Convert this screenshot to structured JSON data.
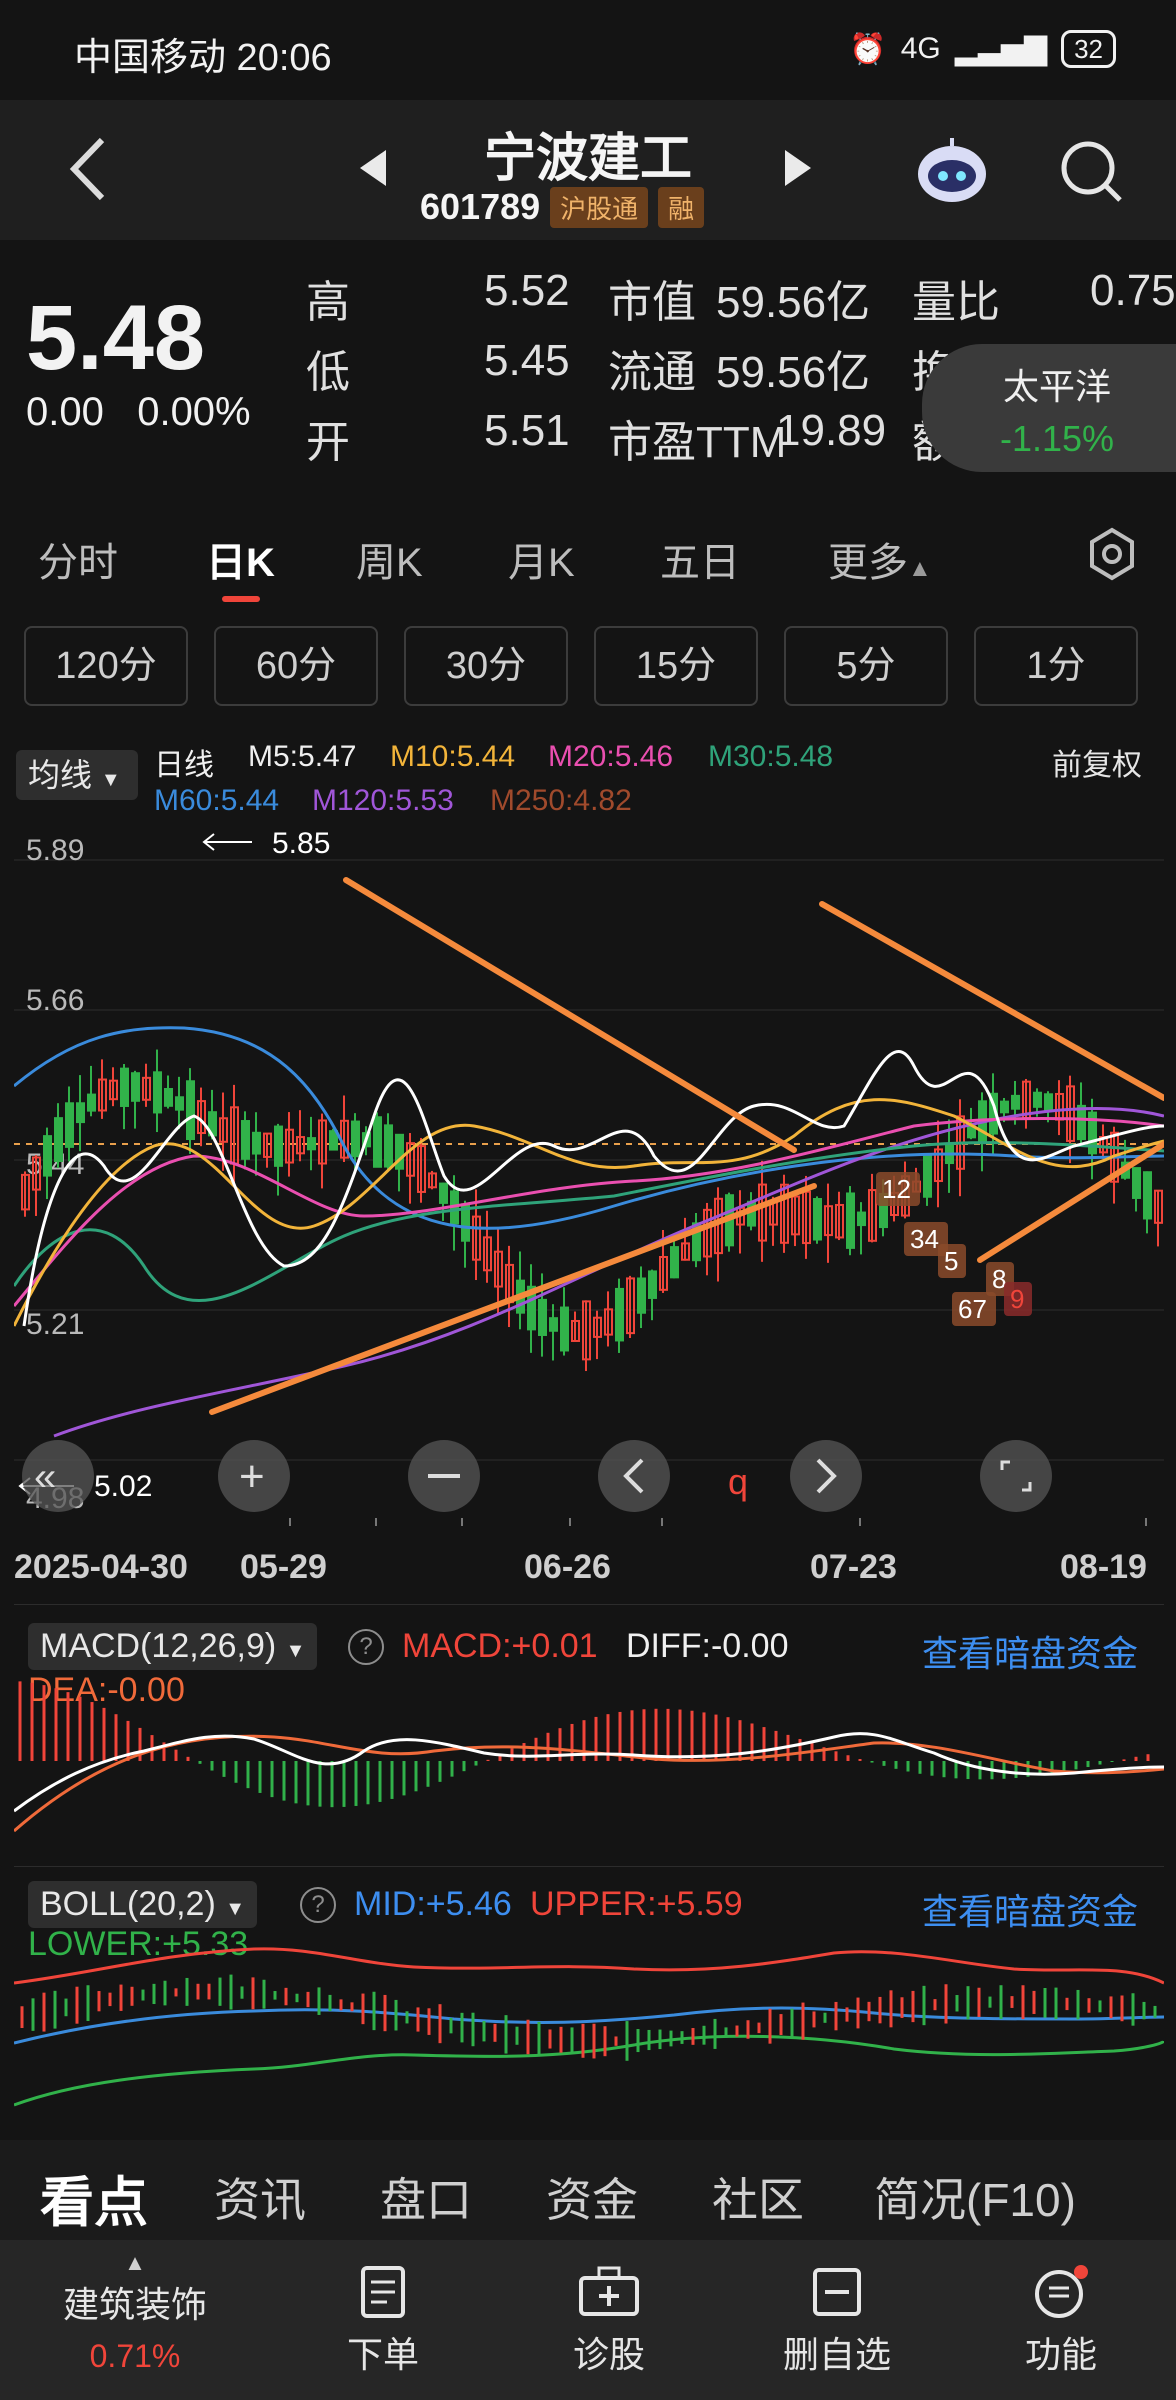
{
  "status": {
    "carrier_time": "中国移动 20:06",
    "net": "4G",
    "battery": "32"
  },
  "header": {
    "title": "宁波建工",
    "code": "601789",
    "tag": "沪股通",
    "tag2": "融"
  },
  "quote": {
    "price": "5.48",
    "change": "0.00",
    "change_pct": "0.00%",
    "rows": [
      {
        "label": "高",
        "value": "5.52",
        "label2": "市值",
        "value2": "59.56亿",
        "label3": "量比",
        "value3": "0.75"
      },
      {
        "label": "低",
        "value": "5.45",
        "label2": "流通",
        "value2": "59.56亿",
        "label3": "换"
      },
      {
        "label": "开",
        "value": "5.51",
        "label2": "市盈TTM",
        "value2": "19.89",
        "label3": "额"
      }
    ],
    "popup": {
      "name": "太平洋",
      "pct": "-1.15%"
    }
  },
  "period_tabs": [
    "分时",
    "日K",
    "周K",
    "月K",
    "五日",
    "更多"
  ],
  "minute_buttons": [
    "120分",
    "60分",
    "30分",
    "15分",
    "5分",
    "1分"
  ],
  "legend": {
    "selector": "均线",
    "line_type": "日线",
    "m5": "M5:5.47",
    "m10": "M10:5.44",
    "m20": "M20:5.46",
    "m30": "M30:5.48",
    "m60": "M60:5.44",
    "m120": "M120:5.53",
    "m250": "M250:4.82",
    "adjust": "前复权"
  },
  "kchart": {
    "y_labels": [
      "5.89",
      "5.66",
      "5.44",
      "5.21",
      "4.98"
    ],
    "high_mark": "5.85",
    "low_mark": "5.02",
    "dates": [
      "2025-04-30",
      "05-29",
      "06-26",
      "07-23",
      "08-19"
    ],
    "annotations": [
      "12",
      "34",
      "5",
      "67",
      "8",
      "9"
    ]
  },
  "macd": {
    "selector": "MACD(12,26,9)",
    "macd": "MACD:+0.01",
    "diff": "DIFF:-0.00",
    "dea": "DEA:-0.00",
    "link": "查看暗盘资金"
  },
  "boll": {
    "selector": "BOLL(20,2)",
    "mid": "MID:+5.46",
    "upper": "UPPER:+5.59",
    "lower": "LOWER:+5.33",
    "link": "查看暗盘资金"
  },
  "content_tabs": [
    "看点",
    "资讯",
    "盘口",
    "资金",
    "社区",
    "简况(F10)"
  ],
  "bottom": {
    "sector": "建筑装饰",
    "sector_pct": "0.71%",
    "order": "下单",
    "diagnose": "诊股",
    "remove_fav": "删自选",
    "functions": "功能"
  },
  "colors": {
    "up": "#f0453a",
    "down": "#31b24a",
    "trend": "#f58a3c",
    "link": "#3d8ef0"
  }
}
